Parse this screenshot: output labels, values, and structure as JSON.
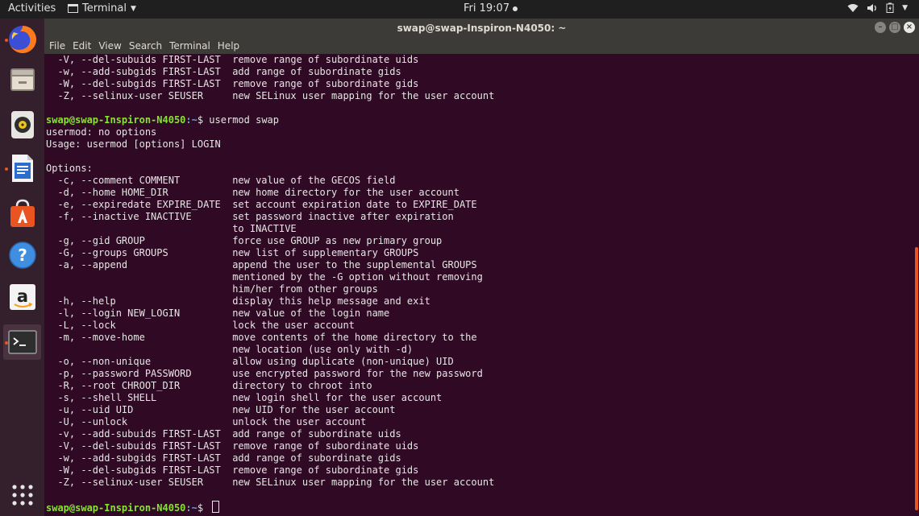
{
  "topbar": {
    "activities": "Activities",
    "app_name": "Terminal",
    "clock": "Fri 19:07"
  },
  "dock": {
    "items": [
      {
        "name": "firefox",
        "icon": "firefox-icon",
        "running": true
      },
      {
        "name": "files",
        "icon": "files-icon",
        "running": false
      },
      {
        "name": "rhythmbox",
        "icon": "rhythmbox-icon",
        "running": false
      },
      {
        "name": "libreoffice-writer",
        "icon": "writer-icon",
        "running": true
      },
      {
        "name": "software",
        "icon": "software-center-icon",
        "running": false
      },
      {
        "name": "help",
        "icon": "help-icon",
        "running": false
      },
      {
        "name": "amazon",
        "icon": "amazon-icon",
        "running": false
      },
      {
        "name": "terminal",
        "icon": "terminal-icon",
        "running": true,
        "active": true
      }
    ],
    "show_apps_icon": "grid-icon"
  },
  "window": {
    "title": "swap@swap-Inspiron-N4050: ~",
    "menu": [
      "File",
      "Edit",
      "View",
      "Search",
      "Terminal",
      "Help"
    ]
  },
  "terminal": {
    "prompt_user": "swap@swap-Inspiron-N4050",
    "prompt_path": ":~",
    "lines": [
      {
        "text": "  -V, --del-subuids FIRST-LAST  remove range of subordinate uids"
      },
      {
        "text": "  -w, --add-subgids FIRST-LAST  add range of subordinate gids"
      },
      {
        "text": "  -W, --del-subgids FIRST-LAST  remove range of subordinate gids"
      },
      {
        "text": "  -Z, --selinux-user SEUSER     new SELinux user mapping for the user account"
      },
      {
        "text": ""
      },
      {
        "prompt": true,
        "cmd": "$ usermod swap"
      },
      {
        "text": "usermod: no options"
      },
      {
        "text": "Usage: usermod [options] LOGIN"
      },
      {
        "text": ""
      },
      {
        "text": "Options:"
      },
      {
        "text": "  -c, --comment COMMENT         new value of the GECOS field"
      },
      {
        "text": "  -d, --home HOME_DIR           new home directory for the user account"
      },
      {
        "text": "  -e, --expiredate EXPIRE_DATE  set account expiration date to EXPIRE_DATE"
      },
      {
        "text": "  -f, --inactive INACTIVE       set password inactive after expiration"
      },
      {
        "text": "                                to INACTIVE"
      },
      {
        "text": "  -g, --gid GROUP               force use GROUP as new primary group"
      },
      {
        "text": "  -G, --groups GROUPS           new list of supplementary GROUPS"
      },
      {
        "text": "  -a, --append                  append the user to the supplemental GROUPS"
      },
      {
        "text": "                                mentioned by the -G option without removing"
      },
      {
        "text": "                                him/her from other groups"
      },
      {
        "text": "  -h, --help                    display this help message and exit"
      },
      {
        "text": "  -l, --login NEW_LOGIN         new value of the login name"
      },
      {
        "text": "  -L, --lock                    lock the user account"
      },
      {
        "text": "  -m, --move-home               move contents of the home directory to the"
      },
      {
        "text": "                                new location (use only with -d)"
      },
      {
        "text": "  -o, --non-unique              allow using duplicate (non-unique) UID"
      },
      {
        "text": "  -p, --password PASSWORD       use encrypted password for the new password"
      },
      {
        "text": "  -R, --root CHROOT_DIR         directory to chroot into"
      },
      {
        "text": "  -s, --shell SHELL             new login shell for the user account"
      },
      {
        "text": "  -u, --uid UID                 new UID for the user account"
      },
      {
        "text": "  -U, --unlock                  unlock the user account"
      },
      {
        "text": "  -v, --add-subuids FIRST-LAST  add range of subordinate uids"
      },
      {
        "text": "  -V, --del-subuids FIRST-LAST  remove range of subordinate uids"
      },
      {
        "text": "  -w, --add-subgids FIRST-LAST  add range of subordinate gids"
      },
      {
        "text": "  -W, --del-subgids FIRST-LAST  remove range of subordinate gids"
      },
      {
        "text": "  -Z, --selinux-user SEUSER     new SELinux user mapping for the user account"
      },
      {
        "text": ""
      },
      {
        "prompt": true,
        "cmd": "$ ",
        "cursor": true
      }
    ]
  },
  "colors": {
    "terminal_bg": "#300a24",
    "prompt_user": "#8ae234",
    "prompt_path": "#729fcf",
    "accent": "#e95420"
  },
  "scrollbar": {
    "position": 0.97,
    "visible_fraction": 0.57
  }
}
